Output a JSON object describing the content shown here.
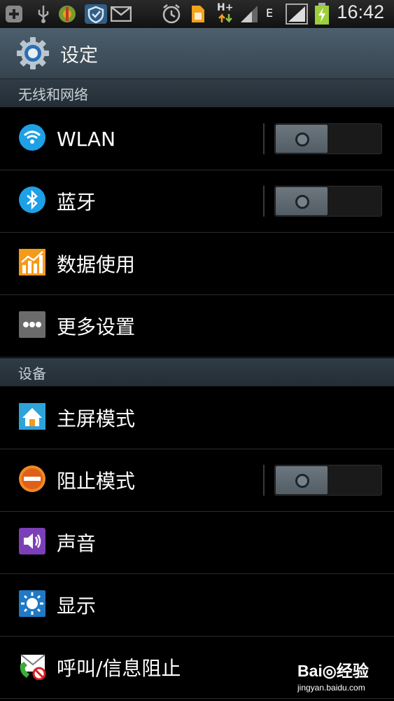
{
  "status_bar": {
    "time": "16:42",
    "network_labels": [
      "H+",
      "E"
    ],
    "icons": [
      "add-icon",
      "usb-icon",
      "game-app-icon",
      "security-shield-icon",
      "mail-icon",
      "alarm-icon",
      "sim-card-icon",
      "data-arrows-icon",
      "signal-icon",
      "signal-icon",
      "battery-charging-icon"
    ]
  },
  "title_bar": {
    "title": "设定",
    "icon": "settings-gear-icon"
  },
  "sections": [
    {
      "header": "无线和网络",
      "items": [
        {
          "label": "WLAN",
          "icon": "wifi-icon",
          "toggle": "off"
        },
        {
          "label": "蓝牙",
          "icon": "bluetooth-icon",
          "toggle": "off"
        },
        {
          "label": "数据使用",
          "icon": "data-usage-chart-icon"
        },
        {
          "label": "更多设置",
          "icon": "more-dots-icon"
        }
      ]
    },
    {
      "header": "设备",
      "items": [
        {
          "label": "主屏模式",
          "icon": "home-screen-icon"
        },
        {
          "label": "阻止模式",
          "icon": "block-mode-icon",
          "toggle": "off"
        },
        {
          "label": "声音",
          "icon": "speaker-icon"
        },
        {
          "label": "显示",
          "icon": "display-brightness-icon"
        },
        {
          "label": "呼叫/信息阻止",
          "icon": "call-message-block-icon"
        }
      ]
    }
  ],
  "watermark": {
    "logo": "Bai◎经验",
    "url": "jingyan.baidu.com"
  },
  "colors": {
    "accent_orange": "#f49b1a",
    "wifi_blue": "#1ea0e6",
    "title_bar": "#40515e",
    "section_header": "#2b363f"
  }
}
